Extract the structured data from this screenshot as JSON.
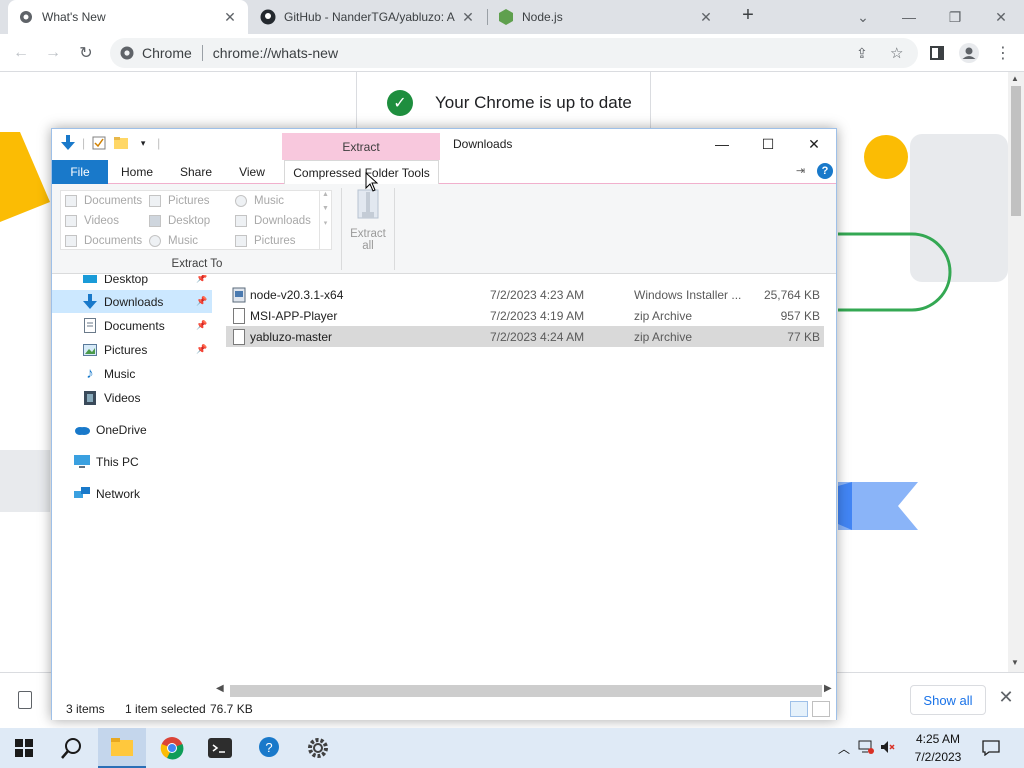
{
  "chrome": {
    "tabs": [
      {
        "title": "What's New",
        "active": true
      },
      {
        "title": "GitHub - NanderTGA/yabluzo: A",
        "active": false
      },
      {
        "title": "Node.js",
        "active": false
      }
    ],
    "new_tab": "+",
    "omnibox": {
      "site": "Chrome",
      "url": "chrome://whats-new"
    },
    "page": {
      "heading": "Your Chrome is up to date"
    },
    "download_bar": {
      "show_all": "Show all"
    }
  },
  "explorer": {
    "title": "Downloads",
    "context_tab_top": "Extract",
    "ribbon_tabs": {
      "file": "File",
      "home": "Home",
      "share": "Share",
      "view": "View",
      "context": "Compressed Folder Tools"
    },
    "extract_to": {
      "items": [
        "Documents",
        "Pictures",
        "Music",
        "Videos",
        "Desktop",
        "Downloads",
        "Documents",
        "Music",
        "Pictures"
      ],
      "group_label": "Extract To"
    },
    "extract_all": {
      "line1": "Extract",
      "line2": "all"
    },
    "nav": {
      "items": [
        {
          "label": "Desktop",
          "pinned": true
        },
        {
          "label": "Downloads",
          "pinned": true,
          "selected": true
        },
        {
          "label": "Documents",
          "pinned": true
        },
        {
          "label": "Pictures",
          "pinned": true
        },
        {
          "label": "Music",
          "pinned": false
        },
        {
          "label": "Videos",
          "pinned": false
        },
        {
          "label": "OneDrive",
          "pinned": false
        },
        {
          "label": "This PC",
          "pinned": false
        },
        {
          "label": "Network",
          "pinned": false
        }
      ]
    },
    "files": [
      {
        "name": "node-v20.3.1-x64",
        "date": "7/2/2023 4:23 AM",
        "type": "Windows Installer ...",
        "size": "25,764 KB"
      },
      {
        "name": "MSI-APP-Player",
        "date": "7/2/2023 4:19 AM",
        "type": "zip Archive",
        "size": "957 KB"
      },
      {
        "name": "yabluzo-master",
        "date": "7/2/2023 4:24 AM",
        "type": "zip Archive",
        "size": "77 KB",
        "selected": true
      }
    ],
    "status": {
      "count": "3 items",
      "selected": "1 item selected",
      "size": "76.7 KB"
    }
  },
  "taskbar": {
    "clock_time": "4:25 AM",
    "clock_date": "7/2/2023"
  },
  "colors": {
    "accent": "#1979ca",
    "context_tab": "#f8c8dd",
    "selection": "#cce8ff",
    "chrome_green": "#1e8e3e"
  }
}
